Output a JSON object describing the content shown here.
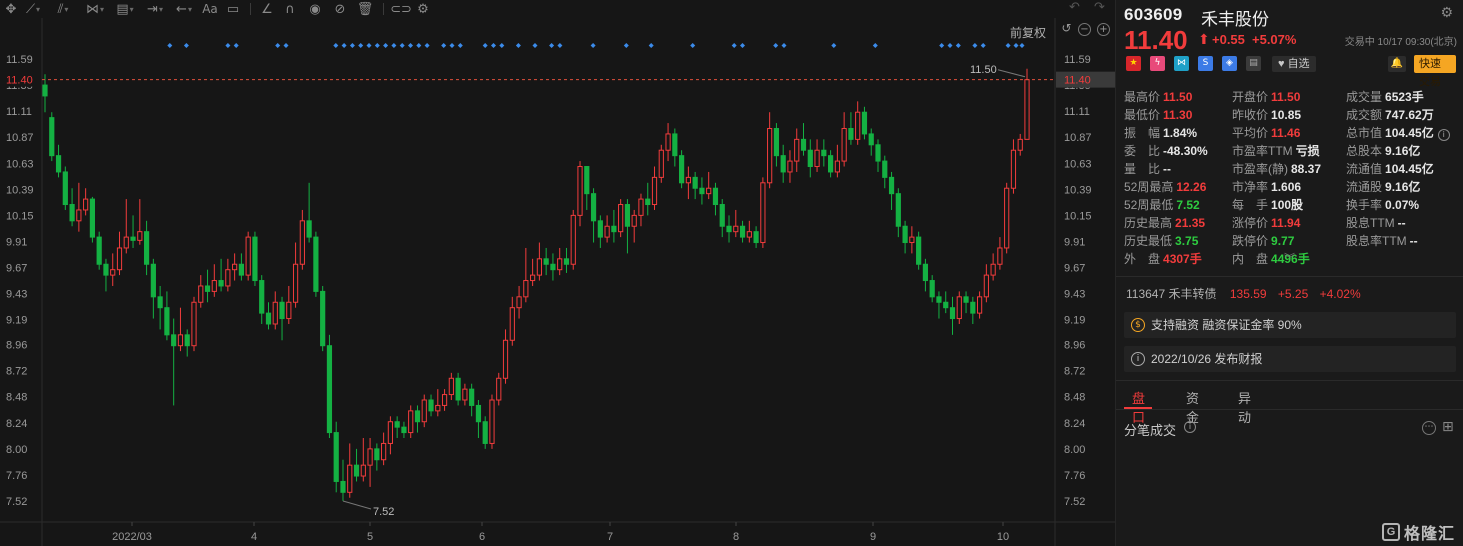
{
  "toolbar": {
    "tools": [
      "move-tool",
      "line-tool",
      "channel-tool",
      "pattern-tool",
      "fib-tool",
      "measure-tool",
      "arrow-tool",
      "text-tool",
      "comment-tool",
      "ruler-tool",
      "magnet-tool",
      "eye-tool",
      "hide-tool",
      "delete-tool",
      "link-tool",
      "settings-tool"
    ],
    "restore_label": "前复权"
  },
  "chart_data": {
    "type": "candlestick",
    "title": "",
    "xlabel": "",
    "ylabel": "",
    "y_ticks": [
      "11.59",
      "11.35",
      "11.11",
      "10.87",
      "10.63",
      "10.39",
      "10.15",
      "9.91",
      "9.67",
      "9.43",
      "9.19",
      "8.96",
      "8.72",
      "8.48",
      "8.24",
      "8.00",
      "7.76",
      "7.52"
    ],
    "x_ticks": [
      "2022/03",
      "4",
      "5",
      "6",
      "7",
      "8",
      "9",
      "10"
    ],
    "ylim": [
      7.43,
      11.82
    ],
    "current_price": "11.40",
    "annotations": {
      "high": "11.50",
      "low": "7.52"
    },
    "grid": false,
    "candles": [
      [
        11.35,
        11.25,
        11.45,
        11.1
      ],
      [
        11.05,
        10.7,
        11.1,
        10.65
      ],
      [
        10.7,
        10.55,
        10.8,
        10.5
      ],
      [
        10.55,
        10.25,
        10.6,
        10.2
      ],
      [
        10.25,
        10.1,
        10.4,
        10.05
      ],
      [
        10.1,
        10.2,
        10.45,
        10.0
      ],
      [
        10.2,
        10.3,
        10.4,
        10.15
      ],
      [
        10.3,
        9.95,
        10.32,
        9.9
      ],
      [
        9.95,
        9.7,
        10.0,
        9.65
      ],
      [
        9.7,
        9.6,
        9.75,
        9.45
      ],
      [
        9.6,
        9.65,
        9.8,
        9.5
      ],
      [
        9.65,
        9.85,
        10.0,
        9.6
      ],
      [
        9.85,
        9.95,
        10.3,
        9.8
      ],
      [
        9.95,
        9.92,
        10.15,
        9.85
      ],
      [
        9.92,
        10.0,
        10.3,
        9.88
      ],
      [
        10.0,
        9.7,
        10.1,
        9.6
      ],
      [
        9.7,
        9.4,
        9.75,
        9.2
      ],
      [
        9.4,
        9.3,
        9.5,
        9.1
      ],
      [
        9.3,
        9.05,
        9.45,
        9.0
      ],
      [
        9.05,
        8.95,
        9.2,
        8.4
      ],
      [
        8.95,
        9.05,
        9.3,
        8.9
      ],
      [
        9.05,
        8.95,
        9.1,
        8.85
      ],
      [
        8.95,
        9.35,
        9.4,
        8.9
      ],
      [
        9.35,
        9.5,
        9.6,
        9.3
      ],
      [
        9.5,
        9.45,
        9.65,
        9.35
      ],
      [
        9.45,
        9.55,
        9.7,
        9.4
      ],
      [
        9.55,
        9.5,
        9.75,
        9.45
      ],
      [
        9.5,
        9.65,
        9.75,
        9.45
      ],
      [
        9.65,
        9.7,
        9.8,
        9.55
      ],
      [
        9.7,
        9.6,
        9.8,
        9.55
      ],
      [
        9.6,
        9.95,
        10.0,
        9.55
      ],
      [
        9.95,
        9.55,
        10.0,
        9.5
      ],
      [
        9.55,
        9.25,
        9.6,
        9.15
      ],
      [
        9.25,
        9.15,
        9.35,
        9.1
      ],
      [
        9.15,
        9.35,
        9.45,
        9.1
      ],
      [
        9.35,
        9.2,
        9.4,
        9.0
      ],
      [
        9.2,
        9.35,
        9.5,
        9.15
      ],
      [
        9.35,
        9.7,
        9.9,
        9.3
      ],
      [
        9.7,
        10.1,
        10.2,
        9.65
      ],
      [
        10.1,
        9.95,
        10.45,
        9.9
      ],
      [
        9.95,
        9.45,
        10.0,
        9.4
      ],
      [
        9.45,
        8.95,
        9.5,
        8.9
      ],
      [
        8.95,
        8.15,
        9.05,
        8.1
      ],
      [
        8.15,
        7.7,
        8.25,
        7.6
      ],
      [
        7.7,
        7.6,
        7.9,
        7.52
      ],
      [
        7.6,
        7.85,
        8.05,
        7.55
      ],
      [
        7.85,
        7.75,
        8.0,
        7.7
      ],
      [
        7.75,
        7.85,
        8.1,
        7.7
      ],
      [
        7.85,
        8.0,
        8.1,
        7.65
      ],
      [
        8.0,
        7.9,
        8.05,
        7.8
      ],
      [
        7.9,
        8.05,
        8.15,
        7.85
      ],
      [
        8.05,
        8.25,
        8.3,
        7.95
      ],
      [
        8.25,
        8.2,
        8.3,
        8.1
      ],
      [
        8.2,
        8.15,
        8.25,
        8.1
      ],
      [
        8.15,
        8.35,
        8.4,
        8.1
      ],
      [
        8.35,
        8.25,
        8.4,
        8.15
      ],
      [
        8.25,
        8.45,
        8.5,
        8.2
      ],
      [
        8.45,
        8.35,
        8.5,
        8.3
      ],
      [
        8.35,
        8.4,
        8.55,
        8.3
      ],
      [
        8.4,
        8.5,
        8.55,
        8.35
      ],
      [
        8.5,
        8.65,
        8.7,
        8.45
      ],
      [
        8.65,
        8.45,
        8.7,
        8.4
      ],
      [
        8.45,
        8.55,
        8.6,
        8.4
      ],
      [
        8.55,
        8.4,
        8.6,
        8.3
      ],
      [
        8.4,
        8.25,
        8.45,
        8.1
      ],
      [
        8.25,
        8.05,
        8.3,
        8.0
      ],
      [
        8.05,
        8.45,
        8.5,
        8.0
      ],
      [
        8.45,
        8.65,
        8.7,
        8.4
      ],
      [
        8.65,
        9.0,
        9.1,
        8.6
      ],
      [
        9.0,
        9.3,
        9.4,
        8.95
      ],
      [
        9.3,
        9.4,
        9.5,
        9.2
      ],
      [
        9.4,
        9.55,
        9.85,
        9.35
      ],
      [
        9.55,
        9.6,
        9.75,
        9.5
      ],
      [
        9.6,
        9.75,
        9.9,
        9.55
      ],
      [
        9.75,
        9.7,
        9.85,
        9.6
      ],
      [
        9.7,
        9.65,
        9.8,
        9.55
      ],
      [
        9.65,
        9.75,
        9.85,
        9.6
      ],
      [
        9.75,
        9.7,
        9.85,
        9.62
      ],
      [
        9.7,
        10.15,
        10.2,
        9.65
      ],
      [
        10.15,
        10.6,
        10.65,
        10.05
      ],
      [
        10.6,
        10.35,
        10.6,
        10.2
      ],
      [
        10.35,
        10.1,
        10.4,
        9.9
      ],
      [
        10.1,
        9.95,
        10.15,
        9.85
      ],
      [
        9.95,
        10.05,
        10.15,
        9.9
      ],
      [
        10.05,
        10.0,
        10.2,
        9.9
      ],
      [
        10.0,
        10.25,
        10.3,
        9.95
      ],
      [
        10.25,
        10.05,
        10.3,
        9.8
      ],
      [
        10.05,
        10.15,
        10.2,
        9.9
      ],
      [
        10.15,
        10.3,
        10.35,
        10.05
      ],
      [
        10.3,
        10.25,
        10.45,
        10.15
      ],
      [
        10.25,
        10.5,
        10.6,
        10.2
      ],
      [
        10.5,
        10.75,
        10.8,
        10.45
      ],
      [
        10.75,
        10.9,
        11.0,
        10.65
      ],
      [
        10.9,
        10.7,
        10.95,
        10.6
      ],
      [
        10.7,
        10.45,
        10.75,
        10.4
      ],
      [
        10.45,
        10.5,
        10.6,
        10.3
      ],
      [
        10.5,
        10.4,
        10.55,
        10.3
      ],
      [
        10.4,
        10.35,
        10.5,
        10.25
      ],
      [
        10.35,
        10.4,
        10.55,
        10.3
      ],
      [
        10.4,
        10.25,
        10.45,
        10.15
      ],
      [
        10.25,
        10.05,
        10.3,
        9.95
      ],
      [
        10.05,
        10.0,
        10.15,
        9.9
      ],
      [
        10.0,
        10.05,
        10.2,
        9.95
      ],
      [
        10.05,
        9.95,
        10.1,
        9.9
      ],
      [
        9.95,
        10.0,
        10.1,
        9.9
      ],
      [
        10.0,
        9.9,
        10.05,
        9.85
      ],
      [
        9.9,
        10.45,
        10.5,
        9.85
      ],
      [
        10.45,
        10.95,
        11.1,
        10.4
      ],
      [
        10.95,
        10.7,
        11.0,
        10.6
      ],
      [
        10.7,
        10.55,
        10.8,
        10.45
      ],
      [
        10.55,
        10.65,
        10.75,
        10.45
      ],
      [
        10.65,
        10.85,
        10.95,
        10.55
      ],
      [
        10.85,
        10.75,
        11.0,
        10.7
      ],
      [
        10.75,
        10.6,
        10.85,
        10.5
      ],
      [
        10.6,
        10.75,
        10.85,
        10.55
      ],
      [
        10.75,
        10.7,
        10.85,
        10.6
      ],
      [
        10.7,
        10.55,
        10.75,
        10.5
      ],
      [
        10.55,
        10.65,
        10.8,
        10.5
      ],
      [
        10.65,
        10.95,
        11.1,
        10.6
      ],
      [
        10.95,
        10.85,
        11.1,
        10.8
      ],
      [
        10.85,
        11.1,
        11.2,
        10.8
      ],
      [
        11.1,
        10.9,
        11.15,
        10.85
      ],
      [
        10.9,
        10.8,
        10.95,
        10.7
      ],
      [
        10.8,
        10.65,
        10.85,
        10.55
      ],
      [
        10.65,
        10.5,
        10.7,
        10.4
      ],
      [
        10.5,
        10.35,
        10.55,
        10.2
      ],
      [
        10.35,
        10.05,
        10.4,
        9.95
      ],
      [
        10.05,
        9.9,
        10.1,
        9.8
      ],
      [
        9.9,
        9.95,
        10.05,
        9.8
      ],
      [
        9.95,
        9.7,
        10.0,
        9.65
      ],
      [
        9.7,
        9.55,
        9.75,
        9.45
      ],
      [
        9.55,
        9.4,
        9.6,
        9.35
      ],
      [
        9.4,
        9.35,
        9.45,
        9.2
      ],
      [
        9.35,
        9.3,
        9.45,
        9.25
      ],
      [
        9.3,
        9.2,
        9.4,
        9.05
      ],
      [
        9.2,
        9.4,
        9.45,
        9.15
      ],
      [
        9.4,
        9.35,
        9.45,
        9.25
      ],
      [
        9.35,
        9.25,
        9.4,
        9.15
      ],
      [
        9.25,
        9.4,
        9.45,
        9.2
      ],
      [
        9.4,
        9.6,
        9.7,
        9.35
      ],
      [
        9.6,
        9.7,
        9.8,
        9.55
      ],
      [
        9.7,
        9.85,
        9.95,
        9.65
      ],
      [
        9.85,
        10.4,
        10.45,
        9.8
      ],
      [
        10.4,
        10.75,
        10.85,
        10.35
      ],
      [
        10.75,
        10.85,
        10.9,
        10.7
      ],
      [
        10.85,
        11.4,
        11.5,
        11.3
      ]
    ],
    "up_color": "#f23c3c",
    "down_color": "#14b143",
    "marker_color": "#3b8bea"
  },
  "quote": {
    "code": "603609",
    "name": "禾丰股份",
    "price": "11.40",
    "change": "+0.55",
    "change_pct": "+5.07%",
    "status": "交易中 10/17 09:30(北京)",
    "watchlist_label": "♥ 自选",
    "quick_trade_label": "快速交易"
  },
  "stats": {
    "c1": [
      {
        "k": "最高价",
        "v": "11.50",
        "c": "red"
      },
      {
        "k": "最低价",
        "v": "11.30",
        "c": "red"
      },
      {
        "k": "振　幅",
        "v": "1.84%",
        "c": "white"
      },
      {
        "k": "委　比",
        "v": "-48.30%",
        "c": "white"
      },
      {
        "k": "量　比",
        "v": "--",
        "c": "white"
      },
      {
        "k": "52周最高",
        "v": "12.26",
        "c": "red"
      },
      {
        "k": "52周最低",
        "v": "7.52",
        "c": "green"
      },
      {
        "k": "历史最高",
        "v": "21.35",
        "c": "red"
      },
      {
        "k": "历史最低",
        "v": "3.75",
        "c": "green"
      },
      {
        "k": "外　盘",
        "v": "4307手",
        "c": "red"
      }
    ],
    "c2": [
      {
        "k": "开盘价",
        "v": "11.50",
        "c": "red"
      },
      {
        "k": "昨收价",
        "v": "10.85",
        "c": "white"
      },
      {
        "k": "平均价",
        "v": "11.46",
        "c": "red"
      },
      {
        "k": "市盈率TTM",
        "v": "亏损",
        "c": "white"
      },
      {
        "k": "市盈率(静)",
        "v": "88.37",
        "c": "white"
      },
      {
        "k": "市净率",
        "v": "1.606",
        "c": "white"
      },
      {
        "k": "每　手",
        "v": "100股",
        "c": "white"
      },
      {
        "k": "涨停价",
        "v": "11.94",
        "c": "red"
      },
      {
        "k": "跌停价",
        "v": "9.77",
        "c": "green"
      },
      {
        "k": "内　盘",
        "v": "4496手",
        "c": "green"
      }
    ],
    "c3": [
      {
        "k": "成交量",
        "v": "6523手",
        "c": "white"
      },
      {
        "k": "成交额",
        "v": "747.62万",
        "c": "white"
      },
      {
        "k": "总市值",
        "v": "104.45亿",
        "c": "white"
      },
      {
        "k": "总股本",
        "v": "9.16亿",
        "c": "white"
      },
      {
        "k": "流通值",
        "v": "104.45亿",
        "c": "white"
      },
      {
        "k": "流通股",
        "v": "9.16亿",
        "c": "white"
      },
      {
        "k": "换手率",
        "v": "0.07%",
        "c": "white"
      },
      {
        "k": "股息TTM",
        "v": "--",
        "c": "white"
      },
      {
        "k": "股息率TTM",
        "v": "--",
        "c": "white"
      }
    ]
  },
  "bond": {
    "name": "113647 禾丰转债",
    "price": "135.59",
    "change": "+5.25",
    "change_pct": "+4.02%"
  },
  "notices": {
    "margin": "支持融资 融资保证金率 90%",
    "report": "2022/10/26 发布财报"
  },
  "tabs": [
    "盘口",
    "资金",
    "异动"
  ],
  "ticks_label": "分笔成交",
  "logo_text": "格隆汇"
}
